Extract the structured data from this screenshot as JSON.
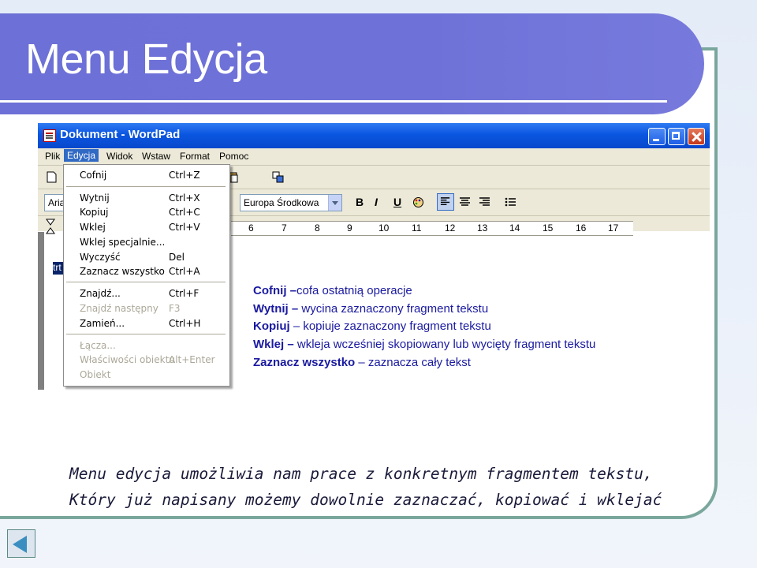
{
  "slide": {
    "title": "Menu Edycja",
    "footer_line1": "Menu edycja umożliwia nam prace z konkretnym fragmentem tekstu,",
    "footer_line2": "Który już napisany możemy dowolnie zaznaczać, kopiować i wklejać"
  },
  "window": {
    "title": "Dokument - WordPad",
    "menubar": [
      "Plik",
      "Edycja",
      "Widok",
      "Wstaw",
      "Format",
      "Pomoc"
    ],
    "font_name": "Aria",
    "script_name": "Europa Środkowa",
    "selected_text": "trt",
    "ruler_numbers": [
      "6",
      "7",
      "8",
      "9",
      "10",
      "11",
      "12",
      "13",
      "14",
      "15",
      "16",
      "17"
    ]
  },
  "edit_menu": {
    "items": [
      {
        "label": "Cofnij",
        "shortcut": "Ctrl+Z",
        "disabled": false
      },
      {
        "label": "Wytnij",
        "shortcut": "Ctrl+X",
        "disabled": false
      },
      {
        "label": "Kopiuj",
        "shortcut": "Ctrl+C",
        "disabled": false
      },
      {
        "label": "Wklej",
        "shortcut": "Ctrl+V",
        "disabled": false
      },
      {
        "label": "Wklej specjalnie...",
        "shortcut": "",
        "disabled": false
      },
      {
        "label": "Wyczyść",
        "shortcut": "Del",
        "disabled": false
      },
      {
        "label": "Zaznacz wszystko",
        "shortcut": "Ctrl+A",
        "disabled": false
      },
      {
        "label": "Znajdź...",
        "shortcut": "Ctrl+F",
        "disabled": false
      },
      {
        "label": "Znajdź następny",
        "shortcut": "F3",
        "disabled": true
      },
      {
        "label": "Zamień...",
        "shortcut": "Ctrl+H",
        "disabled": false
      },
      {
        "label": "Łącza...",
        "shortcut": "",
        "disabled": true
      },
      {
        "label": "Właściwości obiektu",
        "shortcut": "Alt+Enter",
        "disabled": true
      },
      {
        "label": "Obiekt",
        "shortcut": "",
        "disabled": true
      }
    ]
  },
  "descriptions": [
    {
      "term": "Cofnij –",
      "text": "cofa ostatnią operacje"
    },
    {
      "term": "Wytnij –",
      "text": "wycina zaznaczony fragment tekstu"
    },
    {
      "term": "Kopiuj",
      "text": "– kopiuje zaznaczony fragment tekstu"
    },
    {
      "term": "Wklej –",
      "text": "wkleja wcześniej skopiowany lub wycięty fragment tekstu"
    },
    {
      "term": "Zaznacz wszystko",
      "text": "– zaznacza cały tekst"
    }
  ],
  "colors": {
    "title_bar": "#6d70d6",
    "frame_border": "#7aa79c",
    "xp_title": "#0a56e0",
    "description_text": "#1a1aa0"
  }
}
